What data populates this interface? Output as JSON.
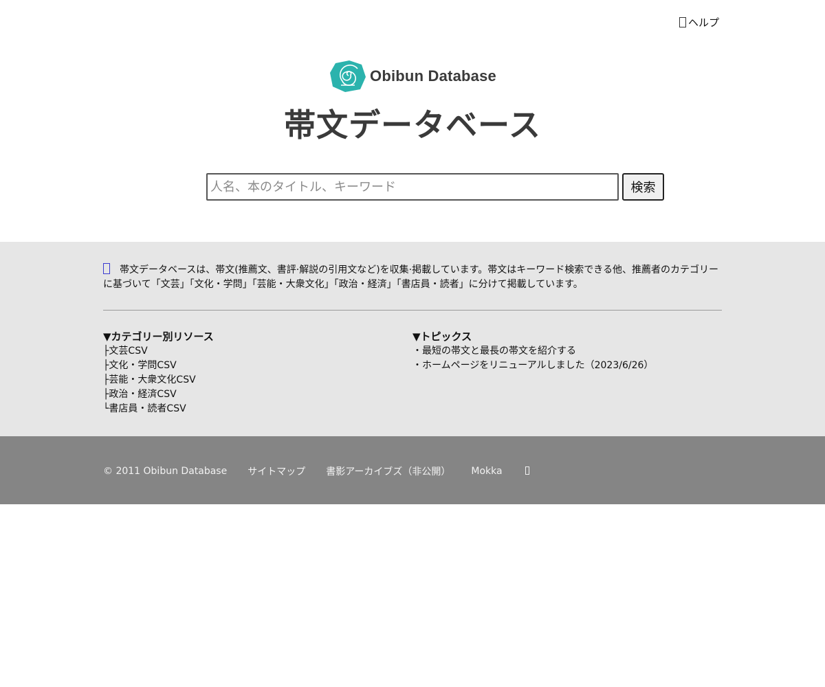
{
  "header": {
    "help_label": "ヘルプ",
    "logo_text": "Obibun Database",
    "title": "帯文データベース",
    "logo_color": "#2bb3ad"
  },
  "search": {
    "placeholder": "人名、本のタイトル、キーワード",
    "value": "",
    "button_label": "検索"
  },
  "intro": {
    "text": "帯文データベースは、帯文(推薦文、書評·解説の引用文など)を収集·掲載しています。帯文はキーワード検索できる他、推薦者のカテゴリーに基づいて「文芸」「文化・学問」「芸能・大衆文化」「政治・経済」「書店員・読者」に分けて掲載しています。"
  },
  "categories": {
    "heading": "▼カテゴリー別リソース",
    "items": [
      "├文芸CSV",
      "├文化・学問CSV",
      "├芸能・大衆文化CSV",
      "├政治・経済CSV",
      "└書店員・読者CSV"
    ]
  },
  "topics": {
    "heading": "▼トピックス",
    "items": [
      "・最短の帯文と最長の帯文を紹介する",
      "・ホームページをリニューアルしました（2023/6/26）"
    ]
  },
  "footer": {
    "copyright": "© 2011 Obibun Database",
    "links": [
      "サイトマップ",
      "書影アーカイブズ（非公開）",
      "Mokka"
    ]
  },
  "colors": {
    "info_bg": "#e6e6e6",
    "footer_bg": "#858585",
    "title_text": "#3a3a3a"
  }
}
